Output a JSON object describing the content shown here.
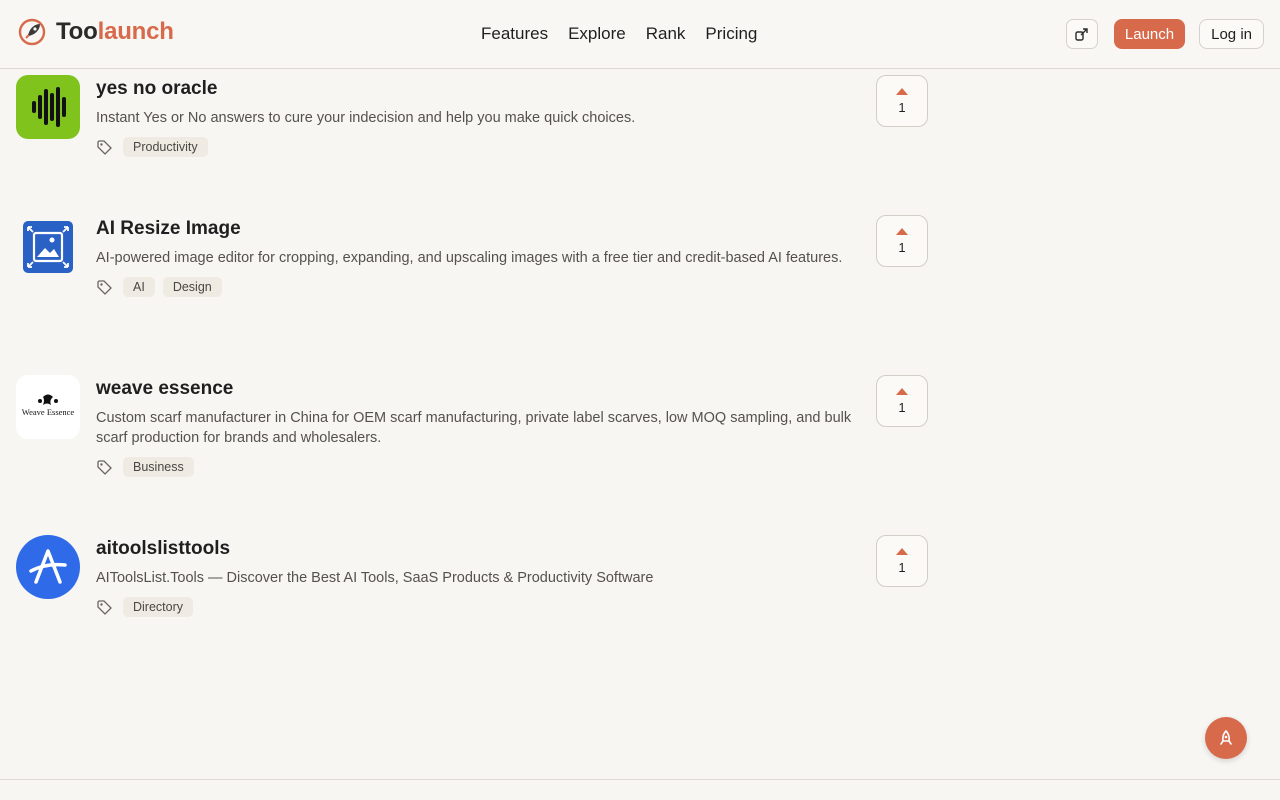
{
  "brand": {
    "name_a": "Too",
    "name_b": "launch"
  },
  "nav": {
    "features": "Features",
    "explore": "Explore",
    "rank": "Rank",
    "pricing": "Pricing"
  },
  "header": {
    "launch_label": "Launch",
    "login_label": "Log in",
    "icons": [
      "external-share-icon"
    ]
  },
  "colors": {
    "accent": "#d86a4c",
    "background": "#f7f6f3",
    "tag_bg": "#efebe3"
  },
  "items": [
    {
      "title": "yes no oracle",
      "description": "Instant Yes or No answers to cure your indecision and help you make quick choices.",
      "tags": [
        "Productivity"
      ],
      "votes": "1",
      "logo_icon": "sound-wave-icon",
      "logo_color": "#7fc31c"
    },
    {
      "title": "AI Resize Image",
      "description": "AI-powered image editor for cropping, expanding, and upscaling images with a free tier and credit-based AI features.",
      "tags": [
        "AI",
        "Design"
      ],
      "votes": "1",
      "logo_icon": "image-resize-icon",
      "logo_color": "#2a61c5"
    },
    {
      "title": "weave essence",
      "description": "Custom scarf manufacturer in China for OEM scarf manufacturing, private label scarves, low MOQ sampling, and bulk scarf production for brands and wholesalers.",
      "tags": [
        "Business"
      ],
      "votes": "1",
      "logo_icon": "weave-essence-logo",
      "logo_text": "Weave Essence"
    },
    {
      "title": "aitoolslisttools",
      "description": "AIToolsList.Tools — Discover the Best AI Tools, SaaS Products & Productivity Software",
      "tags": [
        "Directory"
      ],
      "votes": "1",
      "logo_icon": "letter-a-icon",
      "logo_color": "#2f6be8"
    }
  ]
}
